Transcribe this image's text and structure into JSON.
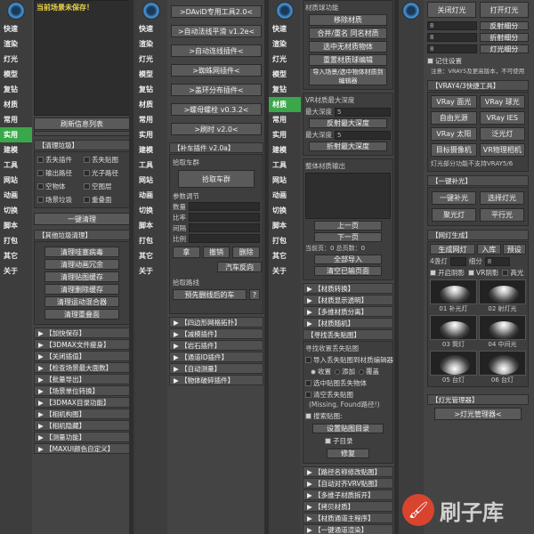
{
  "col1": {
    "side": [
      "快速",
      "渲染",
      "灯光",
      "模型",
      "复钻",
      "材质",
      "常用",
      "实用",
      "建模",
      "工具",
      "网站",
      "动画",
      "切换",
      "脚本",
      "打包",
      "其它",
      "关于"
    ],
    "active_index": 7,
    "notice": "当前场景未保存！",
    "refresh_label": "刷新信息列表",
    "cleanup_title": "【清理垃圾】",
    "cleanup_items": [
      "丢失插件",
      "丢失贴图",
      "输出路径",
      "光子路径",
      "空物体",
      "空图层",
      "场景垃圾",
      "重叠面"
    ],
    "cleanup_btn": "一键清理",
    "other_title": "【其他垃圾清理】",
    "other_btns": [
      "清理哇塞病毒",
      "清理动画冗余",
      "清理贴图缓存",
      "清理删除缓存",
      "清理运动混合器",
      "清理重叠面"
    ],
    "sections": [
      "【加快保存】",
      "【3DMAX文件瘦身】",
      "【关闭插值】",
      "【检查场景最大面数】",
      "【批量导出】",
      "【场景单位转换】",
      "【3DMAX目录功能】",
      "【相机构图】",
      "【相机隐藏】",
      "【测量功能】",
      "【MAXUI颜色自定义】"
    ]
  },
  "col2": {
    "side": [
      "快速",
      "渲染",
      "灯光",
      "模型",
      "复钻",
      "材质",
      "常用",
      "实用",
      "建模",
      "工具",
      "网站",
      "动画",
      "切换",
      "脚本",
      "打包",
      "其它",
      "关于"
    ],
    "plugin_btns": [
      ">DAviD专用工具2.0<",
      ">自动法线平滑 v1.2e<",
      ">自动连线插件<",
      ">蜘蛛网插件<",
      ">盖环分布插件<",
      ">螺母螺栓 v0.3.2<",
      ">刷时 v2.0<"
    ],
    "fill_title": "【补车插件 v2.0a】",
    "pick_label": "拾取车群",
    "pick_btn": "拾取车群",
    "param_label": "参数调节",
    "rows": [
      "数量",
      "比率",
      "间隔",
      "比例"
    ],
    "del_btns": [
      "拿",
      "撤销",
      "删除"
    ],
    "car_reverse": "汽车反向",
    "pick_lines": "拾取路线",
    "set_car": "预先删线后的车",
    "help": "?",
    "sections": [
      "【四边形网格拓扑】",
      "【减模插件】",
      "【岩石插件】",
      "【通道ID插件】",
      "【自动测量】",
      "【物体破碎插件】"
    ]
  },
  "col3": {
    "side": [
      "快速",
      "渲染",
      "灯光",
      "模型",
      "复钻",
      "材质",
      "常用",
      "实用",
      "建模",
      "工具",
      "网站",
      "动画",
      "切换",
      "脚本",
      "打包",
      "其它",
      "关于"
    ],
    "active_index": 5,
    "title": "材质球功能",
    "btns": [
      "移除材质",
      "合并/重名 同名材质",
      "选中无材质物体",
      "重置材质球编辑",
      "导入场景/选中物体材质到编辑器"
    ],
    "depth_title": "VR材质最大深度",
    "depth_label1": "最大深度",
    "depth_val1": "5",
    "depth_btn1": "反射最大深度",
    "depth_label2": "最大深度",
    "depth_val2": "5",
    "depth_btn2": "折射最大深度",
    "browse_title": "整体材质输出",
    "prev": "上一页",
    "next": "下一页",
    "page_info": "当前页：0  总页数：0",
    "import_all": "全部导入",
    "clear": "清空已输页面",
    "sections_a": [
      "【材质转换】",
      "【材质显示透明】",
      "【多维材质分离】",
      "【材质随机】"
    ],
    "find_title": "【寻找丢失贴图】",
    "find_sub": "寻找收置丢失贴图",
    "find_opts": [
      "导入丢失贴图到材质编辑器",
      "选中贴图丢失物体",
      "清空丢失贴图"
    ],
    "radios": [
      "收置",
      "添加",
      "覆盖"
    ],
    "missing": "(Missing, Found路径!)",
    "search_label": "搜索贴图:",
    "search_btn": "设置贴图目录",
    "sub_dir": "子目录",
    "repair": "修复",
    "sections_b": [
      "【路径名称修改贴图】",
      "【自动对齐VRV贴图】",
      "【多维子材质拆开】",
      "【拷贝材质】",
      "【材质通道主程序】",
      "【一键通道渲染】",
      "【模型随机颜色】",
      "【一键材质库】"
    ]
  },
  "col4": {
    "close_btn": "关闭灯光",
    "open_btn": "打开灯光",
    "reflect_btn": "反射细分",
    "refract_btn": "折射细分",
    "light_btn": "灯光细分",
    "remember": "记住设置",
    "note": "注意：VRAY5及更高版本，不可使用",
    "vray_title": "【VRAY4/3快捷工具】",
    "vray_btns": [
      "VRay 面光",
      "VRay 球光",
      "自由光源",
      "VRay IES",
      "VRay 太阳",
      "泛光灯",
      "目标摄像机",
      "VR物理相机"
    ],
    "vray_note": "灯光部分功能不支持VRAY5/6",
    "one_key": "【一键补光】",
    "onekey_btns": [
      "一键补光",
      "选择灯光",
      "聚光灯",
      "平行光"
    ],
    "net_title": "【网灯生成】",
    "gen_btn": "生成网灯",
    "lib_btn": "入库",
    "preset_btn": "预设",
    "count_label": "4盏灯",
    "subdiv_label": "细分",
    "subdiv_val": "8",
    "shadow": "开启阴影",
    "vray_shadow": "VR阴影",
    "high": "高光",
    "thumbs": [
      "01 补光灯",
      "02 射灯光",
      "03 筒灯",
      "04 中间光",
      "05 台灯",
      "06 台灯"
    ],
    "lamp_title": "【灯光管理器】",
    "lamp_btn": ">灯光管理器<",
    "watermark": "刷子库"
  }
}
